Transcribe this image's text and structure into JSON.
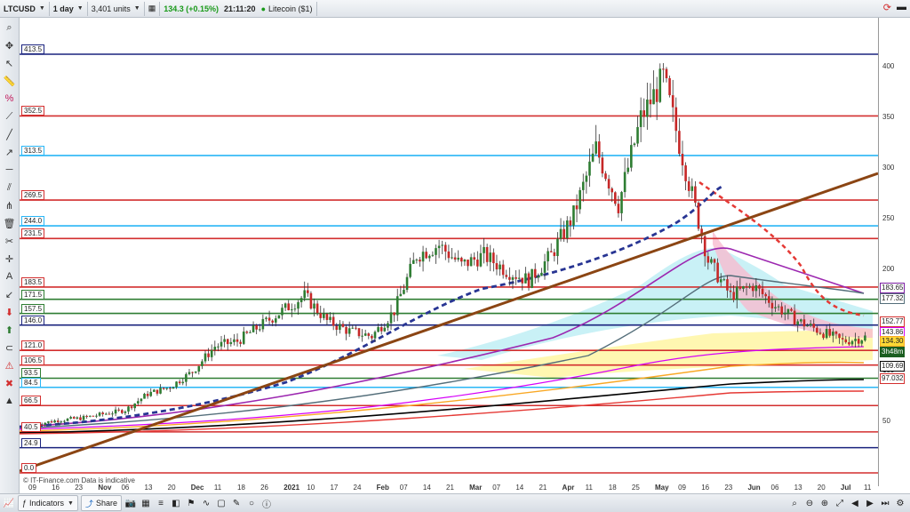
{
  "toolbar": {
    "symbol": "LTCUSD",
    "interval": "1 day",
    "units": "3,401 units",
    "price_change": "134.3 (+0.15%)",
    "time": "21:11:20",
    "instrument": "Litecoin ($1)"
  },
  "watermark": "© IT-Finance.com  Data is indicative",
  "bottom": {
    "indicators_label": "Indicators",
    "share_label": "Share"
  },
  "levels": [
    {
      "label": "413.5",
      "color": "#1a237e"
    },
    {
      "label": "352.5",
      "color": "#d32f2f"
    },
    {
      "label": "313.5",
      "color": "#29b6f6"
    },
    {
      "label": "269.5",
      "color": "#d32f2f"
    },
    {
      "label": "244.0",
      "color": "#29b6f6"
    },
    {
      "label": "231.5",
      "color": "#d32f2f"
    },
    {
      "label": "183.5",
      "color": "#d32f2f"
    },
    {
      "label": "171.5",
      "color": "#2e7d32"
    },
    {
      "label": "157.5",
      "color": "#2e7d32"
    },
    {
      "label": "146.0",
      "color": "#1a237e"
    },
    {
      "label": "121.0",
      "color": "#d32f2f"
    },
    {
      "label": "106.5",
      "color": "#d32f2f"
    },
    {
      "label": "93.5",
      "color": "#2e7d32"
    },
    {
      "label": "84.5",
      "color": "#29b6f6"
    },
    {
      "label": "66.5",
      "color": "#d32f2f"
    },
    {
      "label": "40.5",
      "color": "#d32f2f"
    },
    {
      "label": "24.9",
      "color": "#1a237e"
    },
    {
      "label": "0.0",
      "color": "#d32f2f"
    }
  ],
  "price_ticks": [
    "400",
    "350",
    "300",
    "250",
    "200",
    "150",
    "100",
    "50"
  ],
  "price_tags": [
    {
      "label": "183.65",
      "color": "#7b1fa2"
    },
    {
      "label": "177.32",
      "color": "#546e7a"
    },
    {
      "label": "152.77",
      "color": "#d32f2f"
    },
    {
      "label": "143.86",
      "color": "#d500f9"
    },
    {
      "label": "134.30",
      "color": "#f9a825"
    },
    {
      "label": "3h48m",
      "color": "#1b5e20"
    },
    {
      "label": "109.69",
      "color": "#000000"
    },
    {
      "label": "97.032",
      "color": "#d32f2f"
    }
  ],
  "dates": [
    "09",
    "16",
    "23",
    "Nov",
    "06",
    "13",
    "20",
    "Dec",
    "11",
    "18",
    "26",
    "2021",
    "10",
    "17",
    "24",
    "Feb",
    "07",
    "14",
    "21",
    "Mar",
    "07",
    "14",
    "21",
    "Apr",
    "11",
    "18",
    "25",
    "May",
    "09",
    "16",
    "23",
    "Jun",
    "06",
    "13",
    "20",
    "Jul",
    "11"
  ],
  "chart_data": {
    "type": "candlestick",
    "title": "",
    "ylim": [
      0,
      420
    ],
    "trendline": {
      "color": "#8b4513"
    },
    "ohlc_close_path": [
      48,
      52,
      54,
      58,
      62,
      78,
      85,
      100,
      125,
      130,
      145,
      160,
      175,
      150,
      140,
      135,
      160,
      215,
      225,
      205,
      215,
      200,
      190,
      215,
      255,
      320,
      265,
      350,
      390,
      300,
      210,
      175,
      185,
      165,
      150,
      140,
      130,
      134
    ],
    "last_price": 134.3
  }
}
